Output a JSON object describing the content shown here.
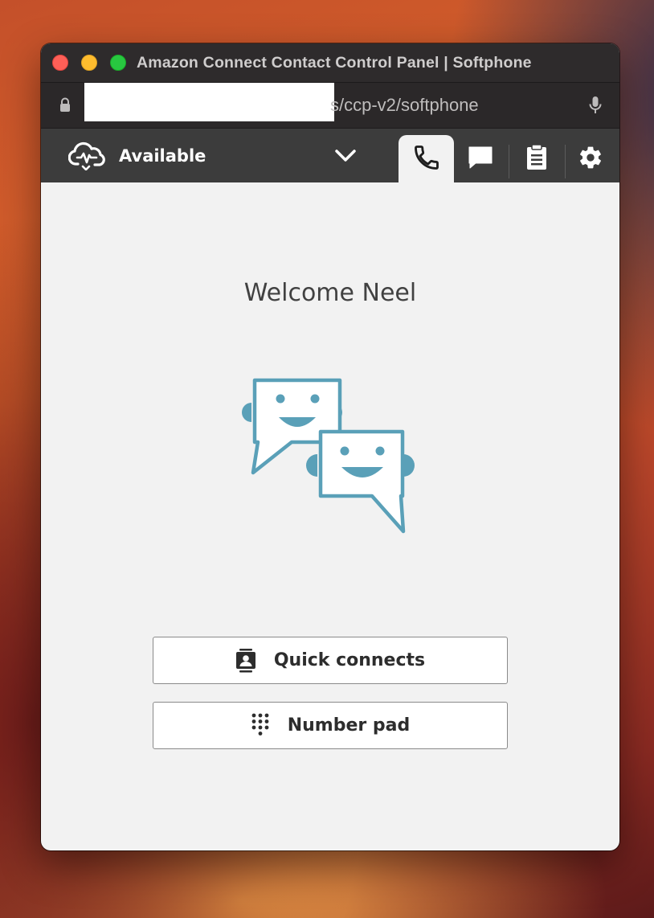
{
  "window": {
    "title": "Amazon Connect Contact Control Panel | Softphone"
  },
  "urlbar": {
    "url_visible": "s/ccp-v2/softphone"
  },
  "nav": {
    "status": "Available",
    "tabs": [
      {
        "name": "phone-icon",
        "active": true
      },
      {
        "name": "chat-icon",
        "active": false
      },
      {
        "name": "task-icon",
        "active": false
      },
      {
        "name": "settings-icon",
        "active": false
      }
    ]
  },
  "main": {
    "welcome": "Welcome Neel",
    "quick_connects_label": "Quick connects",
    "number_pad_label": "Number pad"
  },
  "colors": {
    "navbar": "#3c3c3c",
    "illustration": "#5aa0b8",
    "panel_bg": "#f2f2f2"
  }
}
